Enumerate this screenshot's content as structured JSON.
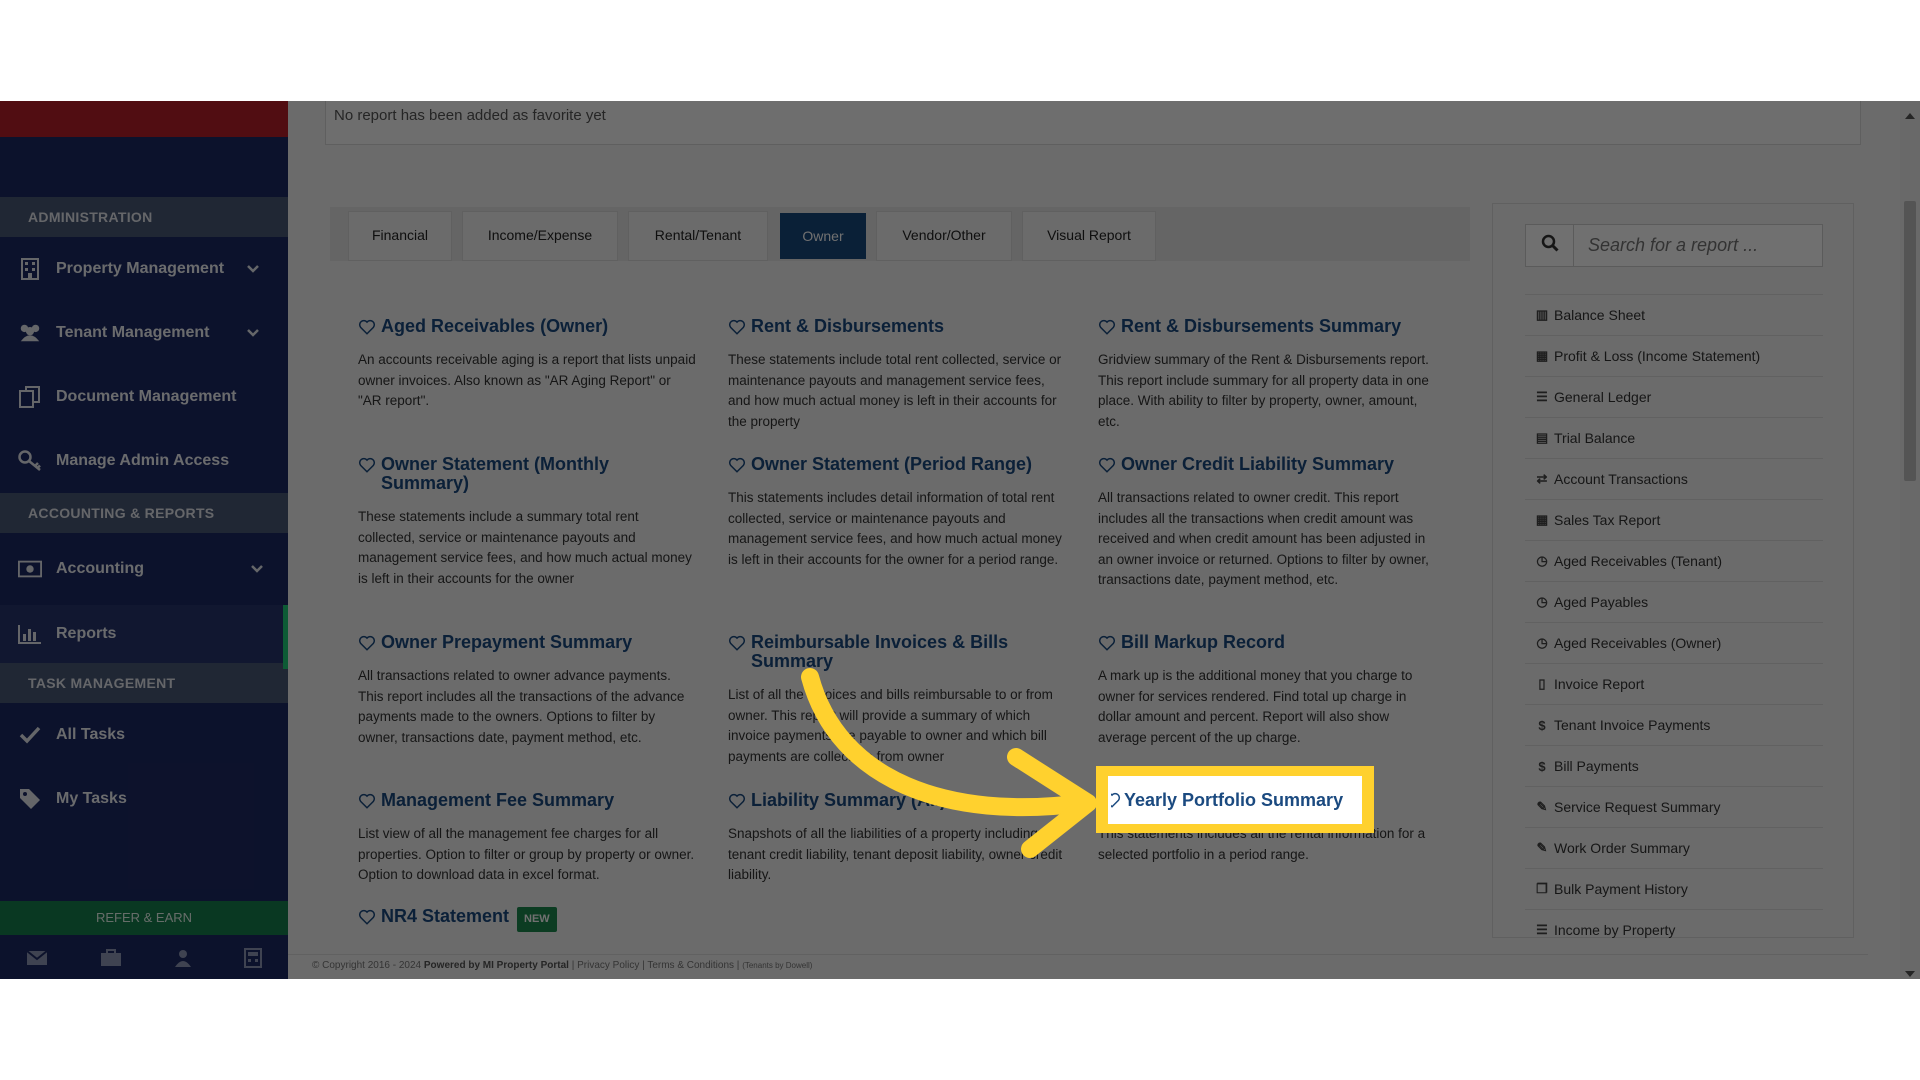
{
  "sidebar": {
    "sections": {
      "admin": "ADMINISTRATION",
      "accounting": "ACCOUNTING & REPORTS",
      "tasks": "TASK MANAGEMENT"
    },
    "items": {
      "property": "Property Management",
      "tenant": "Tenant Management",
      "document": "Document Management",
      "admin_access": "Manage Admin Access",
      "accounting": "Accounting",
      "reports": "Reports",
      "all_tasks": "All Tasks",
      "my_tasks": "My Tasks"
    },
    "refer": "REFER & EARN"
  },
  "favorites": {
    "empty_text": "No report has been added as favorite yet"
  },
  "tabs": {
    "financial": "Financial",
    "income_expense": "Income/Expense",
    "rental_tenant": "Rental/Tenant",
    "owner": "Owner",
    "vendor_other": "Vendor/Other",
    "visual": "Visual Report"
  },
  "reports": {
    "aged_receivables_owner": {
      "title": "Aged Receivables (Owner)",
      "desc": "An accounts receivable aging is a report that lists unpaid owner invoices. Also known as \"AR Aging Report\" or \"AR report\"."
    },
    "rent_disbursements": {
      "title": "Rent & Disbursements",
      "desc": "These statements include total rent collected, service or maintenance payouts and management service fees, and how much actual money is left in their accounts for the property"
    },
    "rent_disbursements_summary": {
      "title": "Rent & Disbursements Summary",
      "desc": "Gridview summary of the Rent & Disbursements report. This report include summary for all property data in one place. With ability to filter by property, owner, amount, etc."
    },
    "owner_statement_monthly": {
      "title": "Owner Statement (Monthly Summary)",
      "desc": "These statements include a summary total rent collected, service or maintenance payouts and management service fees, and how much actual money is left in their accounts for the owner"
    },
    "owner_statement_range": {
      "title": "Owner Statement (Period Range)",
      "desc": "This statements includes detail information of total rent collected, service or maintenance payouts and management service fees, and how much actual money is left in their accounts for the owner for a period range."
    },
    "owner_credit_liability": {
      "title": "Owner Credit Liability Summary",
      "desc": "All transactions related to owner credit. This report includes all the transactions when credit amount was received and when credit amount has been adjusted in an owner invoice or returned. Options to filter by owner, transactions date, payment method, etc."
    },
    "owner_prepayment": {
      "title": "Owner Prepayment Summary",
      "desc": "All transactions related to owner advance payments. This report includes all the transactions of the advance payments made to the owners. Options to filter by owner, transactions date, payment method, etc."
    },
    "reimbursable": {
      "title": "Reimbursable Invoices & Bills Summary",
      "desc": "List of all the invoices and bills reimbursable to or from owner. This report will provide a summary of which invoice payments are payable to owner and which bill payments are collectible from owner"
    },
    "bill_markup": {
      "title": "Bill Markup Record",
      "desc": "A mark up is the additional money that you charge to owner for services rendered. Find total up charge in dollar amount and percent. Report will also show average percent of the up charge."
    },
    "management_fee": {
      "title": "Management Fee Summary",
      "desc": "List view of all the management fee charges for all properties. Option to filter or group by property or owner. Option to download data in excel format."
    },
    "liability_summary": {
      "title": "Liability Summary (All)",
      "desc": "Snapshots of all the liabilities of a property including tenant credit liability, tenant deposit liability, owner credit liability."
    },
    "yearly_portfolio": {
      "title": "Yearly Portfolio Summary",
      "desc": "This statements includes all the rental information for a selected portfolio in a period range."
    },
    "nr4": {
      "title": "NR4 Statement",
      "badge": "NEW"
    }
  },
  "search": {
    "placeholder": "Search for a report ..."
  },
  "quick_links": [
    {
      "icon": "columns-icon",
      "label": "Balance Sheet"
    },
    {
      "icon": "calculator-icon",
      "label": "Profit & Loss (Income Statement)"
    },
    {
      "icon": "list-icon",
      "label": "General Ledger"
    },
    {
      "icon": "calendar-icon",
      "label": "Trial Balance"
    },
    {
      "icon": "exchange-icon",
      "label": "Account Transactions"
    },
    {
      "icon": "calculator-icon",
      "label": "Sales Tax Report"
    },
    {
      "icon": "clock-icon",
      "label": "Aged Receivables (Tenant)"
    },
    {
      "icon": "clock-icon",
      "label": "Aged Payables"
    },
    {
      "icon": "clock-icon",
      "label": "Aged Receivables (Owner)"
    },
    {
      "icon": "file-icon",
      "label": "Invoice Report"
    },
    {
      "icon": "dollar-icon",
      "label": "Tenant Invoice Payments"
    },
    {
      "icon": "dollar-icon",
      "label": "Bill Payments"
    },
    {
      "icon": "wrench-icon",
      "label": "Service Request Summary"
    },
    {
      "icon": "wrench-icon",
      "label": "Work Order Summary"
    },
    {
      "icon": "copy-icon",
      "label": "Bulk Payment History"
    },
    {
      "icon": "list-icon",
      "label": "Income by Property"
    }
  ],
  "footer": {
    "copyright": "© Copyright 2016 - 2024",
    "powered": "Powered by MI Property Portal",
    "privacy": "Privacy Policy",
    "terms": "Terms & Conditions",
    "tenants": "(Tenants by Dowell)"
  },
  "colors": {
    "accent": "#17497e",
    "highlight": "#ffd12e",
    "sidebar": "#1d2a64"
  }
}
